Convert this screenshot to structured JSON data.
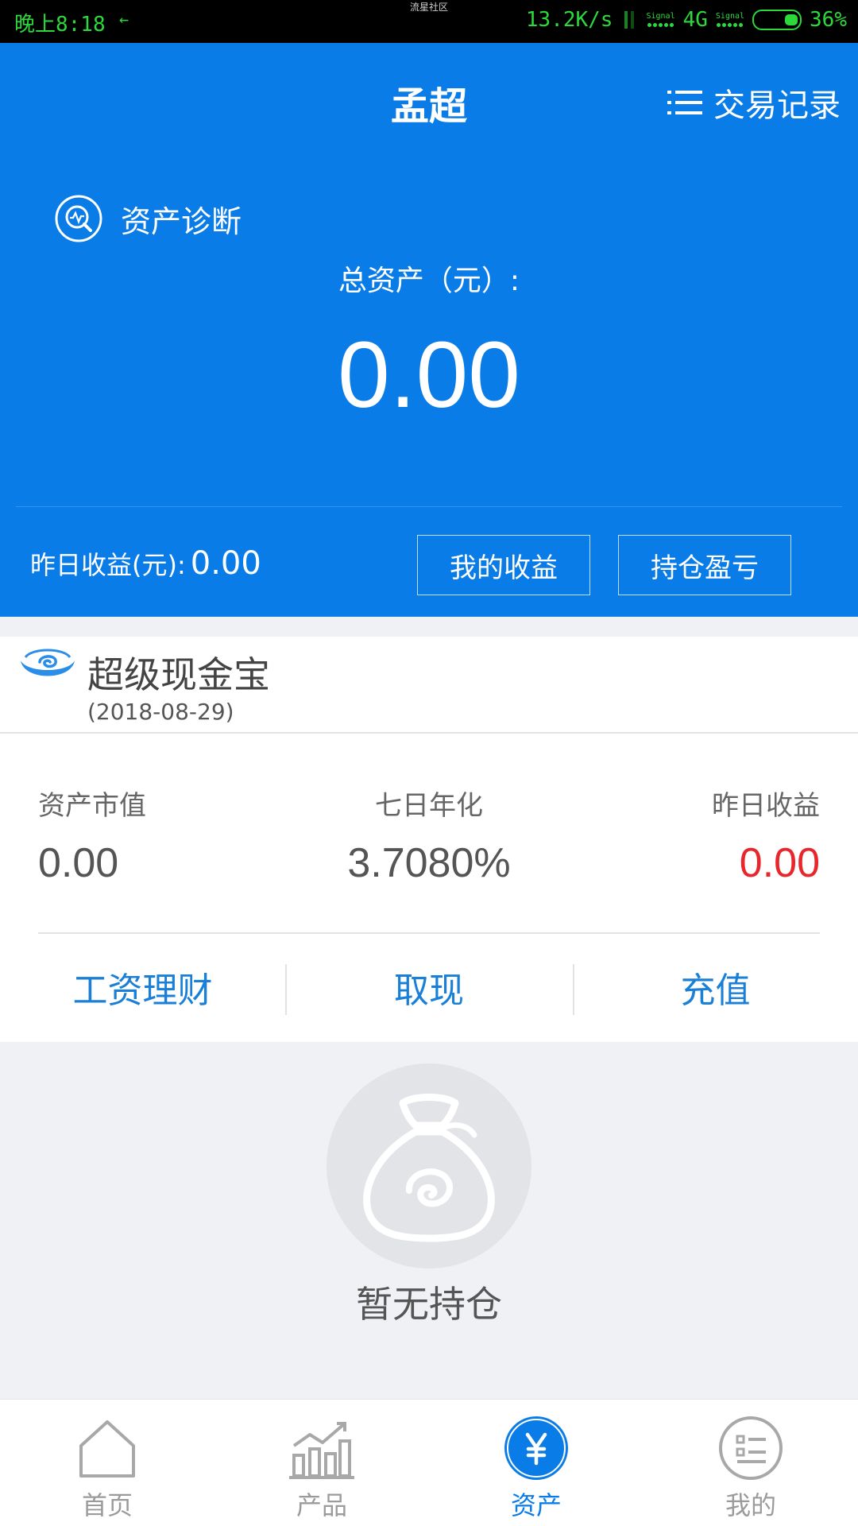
{
  "status_bar": {
    "time": "晚上8:18",
    "arrow": "←",
    "center_text": "流星社区",
    "speed": "13.2K/s",
    "sig_label": "Signal",
    "network": "4G",
    "battery": "36%"
  },
  "header": {
    "title": "孟超",
    "records_label": "交易记录",
    "diagnosis_label": "资产诊断",
    "total_label": "总资产（元）:",
    "total_value": "0.00",
    "yesterday_label": "昨日收益(元):",
    "yesterday_value": "0.00",
    "btn_my_income": "我的收益",
    "btn_holding_pl": "持仓盈亏"
  },
  "fund": {
    "name": "超级现金宝",
    "date": "(2018-08-29)",
    "stats": [
      {
        "label": "资产市值",
        "value": "0.00"
      },
      {
        "label": "七日年化",
        "value": "3.7080%"
      },
      {
        "label": "昨日收益",
        "value": "0.00"
      }
    ],
    "actions": [
      "工资理财",
      "取现",
      "充值"
    ]
  },
  "empty": {
    "text": "暂无持仓"
  },
  "nav": [
    {
      "label": "首页",
      "icon": "home-icon"
    },
    {
      "label": "产品",
      "icon": "chart-icon"
    },
    {
      "label": "资产",
      "icon": "yen-icon"
    },
    {
      "label": "我的",
      "icon": "profile-list-icon"
    }
  ],
  "colors": {
    "primary": "#0a7ce8",
    "action_text": "#1a7fd6",
    "negative": "#e8262b",
    "status_green": "#2bd93a"
  }
}
